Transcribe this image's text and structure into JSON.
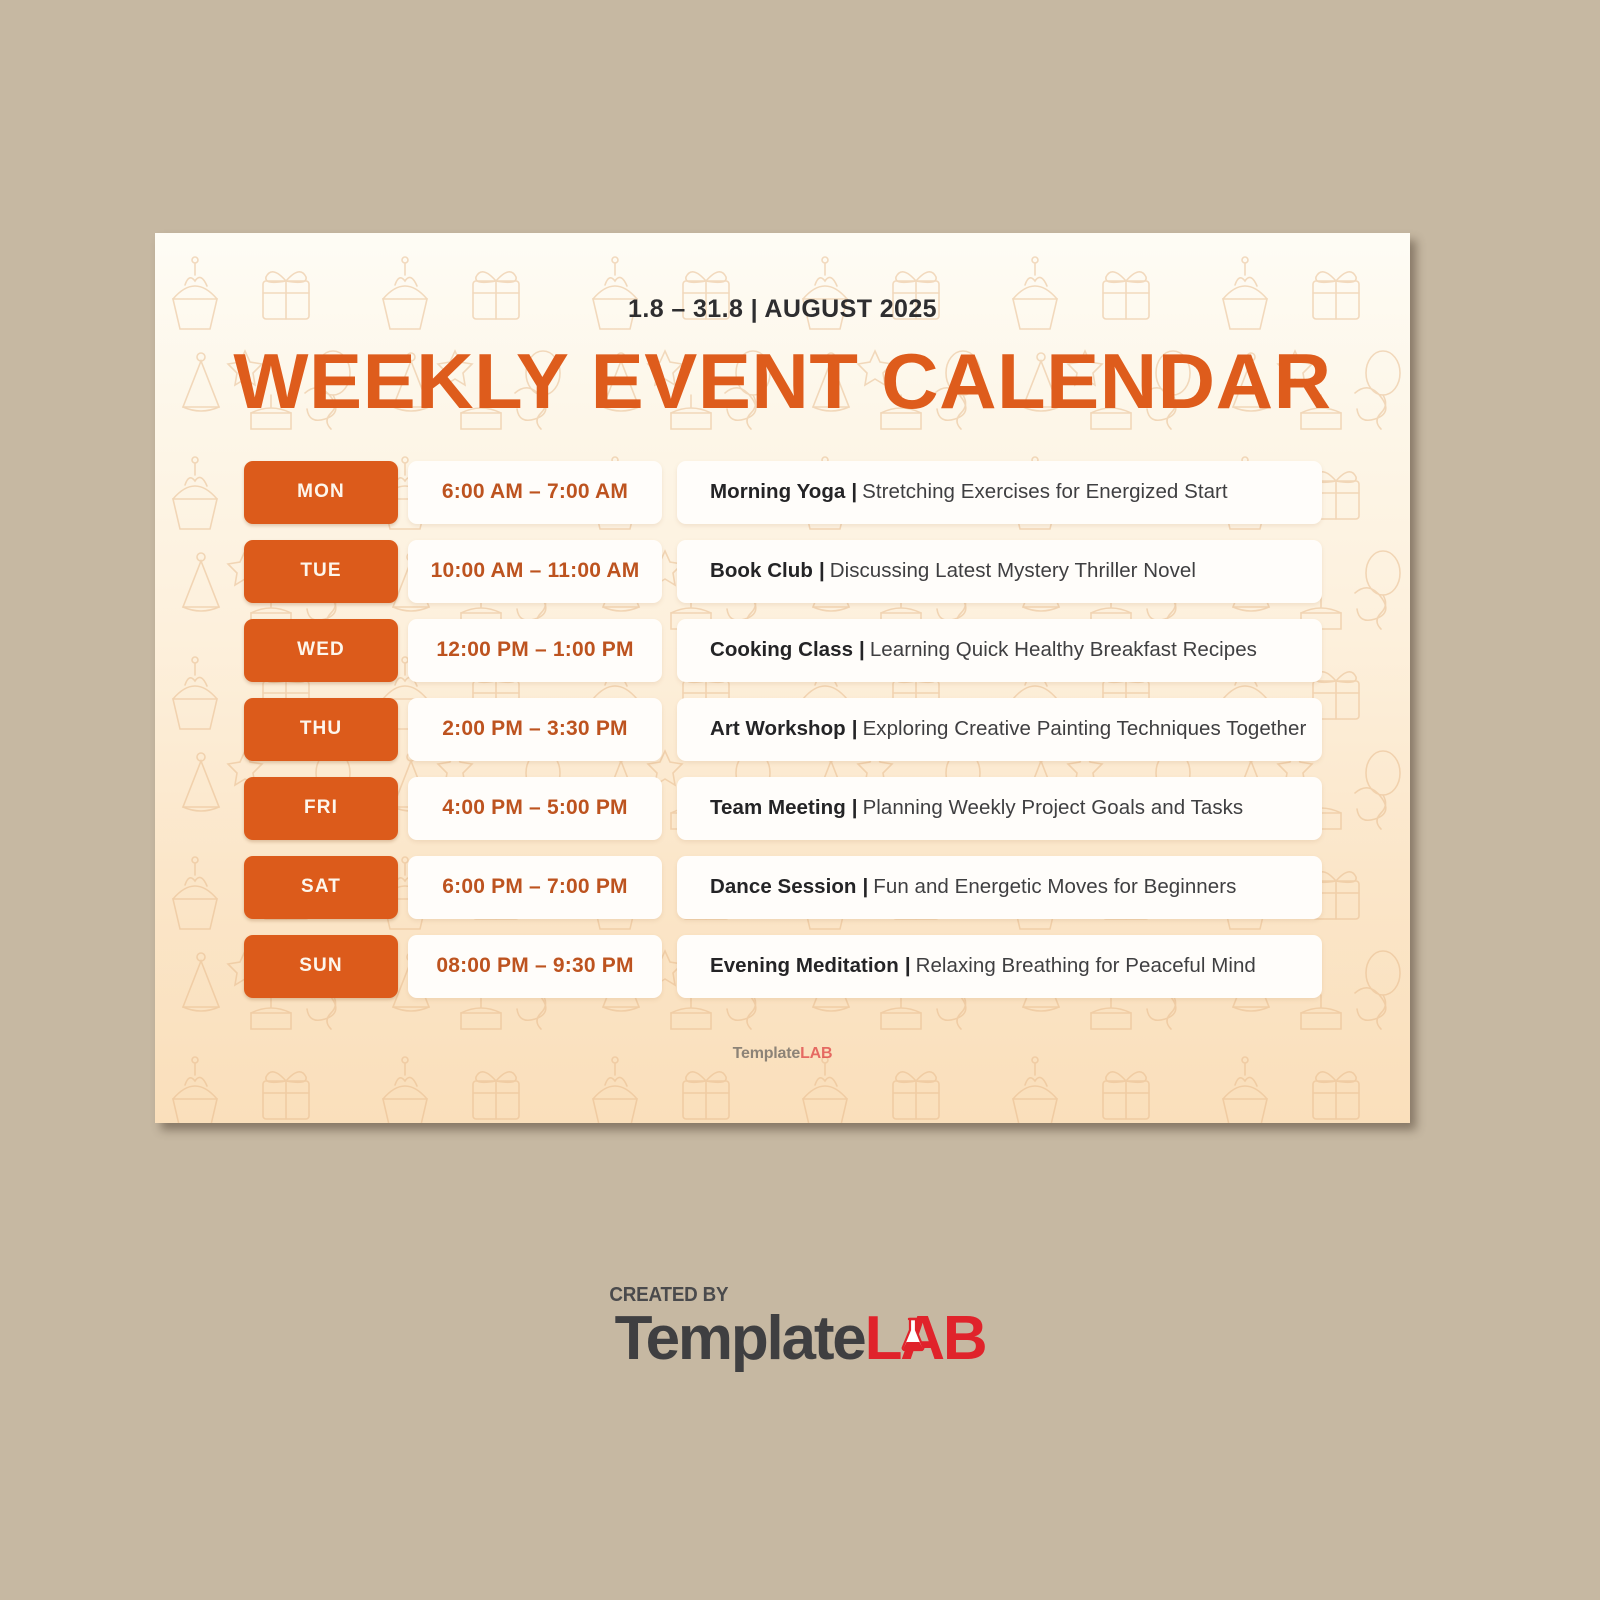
{
  "page": {
    "background_color": "#C6B8A2"
  },
  "poster": {
    "background_gradient_from": "#FEFCF5",
    "background_gradient_to": "#FADFBB",
    "accent_color": "#DC5B1B",
    "date_range": "1.8 – 31.8 | AUGUST 2025",
    "title": "WEEKLY EVENT CALENDAR",
    "watermark": {
      "template": "Template",
      "lab": "LAB"
    }
  },
  "schedule": {
    "rows": [
      {
        "day": "MON",
        "time": "6:00 AM – 7:00 AM",
        "event_title": "Morning Yoga",
        "separator": "|",
        "event_desc": "Stretching Exercises for Energized Start"
      },
      {
        "day": "TUE",
        "time": "10:00 AM – 11:00 AM",
        "event_title": "Book Club",
        "separator": "|",
        "event_desc": "Discussing Latest Mystery Thriller Novel"
      },
      {
        "day": "WED",
        "time": "12:00 PM – 1:00 PM",
        "event_title": "Cooking Class",
        "separator": "|",
        "event_desc": "Learning Quick Healthy Breakfast Recipes"
      },
      {
        "day": "THU",
        "time": "2:00 PM – 3:30 PM",
        "event_title": "Art Workshop",
        "separator": "|",
        "event_desc": "Exploring Creative Painting Techniques Together"
      },
      {
        "day": "FRI",
        "time": "4:00 PM – 5:00 PM",
        "event_title": "Team Meeting",
        "separator": "|",
        "event_desc": "Planning Weekly Project Goals and Tasks"
      },
      {
        "day": "SAT",
        "time": "6:00 PM – 7:00 PM",
        "event_title": "Dance Session",
        "separator": "|",
        "event_desc": "Fun and Energetic Moves for Beginners"
      },
      {
        "day": "SUN",
        "time": "08:00 PM – 9:30 PM",
        "event_title": "Evening Meditation",
        "separator": "|",
        "event_desc": "Relaxing Breathing for Peaceful Mind"
      }
    ]
  },
  "footer": {
    "created_by": "CREATED BY",
    "logo_template": "Template",
    "logo_lab": "LAB",
    "flask_icon": "flask-icon",
    "template_color": "#3F3F41",
    "lab_color": "#E0232B"
  }
}
